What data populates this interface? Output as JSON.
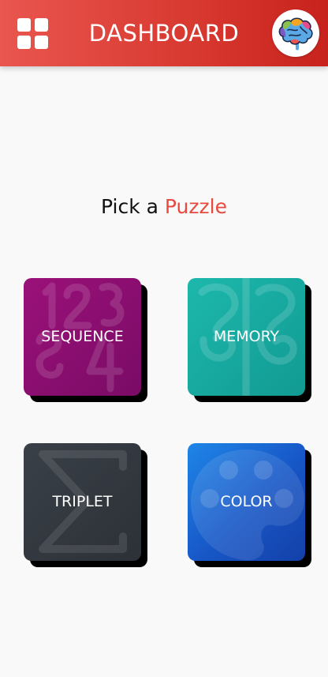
{
  "app_bar": {
    "title": "DASHBOARD",
    "menu_icon": "grid-icon",
    "avatar_icon": "brain-icon",
    "color": "#d7382f"
  },
  "heading": {
    "prefix": "Pick a",
    "accent": "Puzzle",
    "accent_color": "#e64a3f"
  },
  "puzzles": [
    {
      "label": "SEQUENCE",
      "color": "#8a0e70",
      "icon": "numbers-icon"
    },
    {
      "label": "MEMORY",
      "color": "#16aaa0",
      "icon": "memory-pattern-icon"
    },
    {
      "label": "TRIPLET",
      "color": "#33383f",
      "icon": "sigma-icon"
    },
    {
      "label": "COLOR",
      "color": "#1a64d6",
      "icon": "palette-icon"
    }
  ]
}
